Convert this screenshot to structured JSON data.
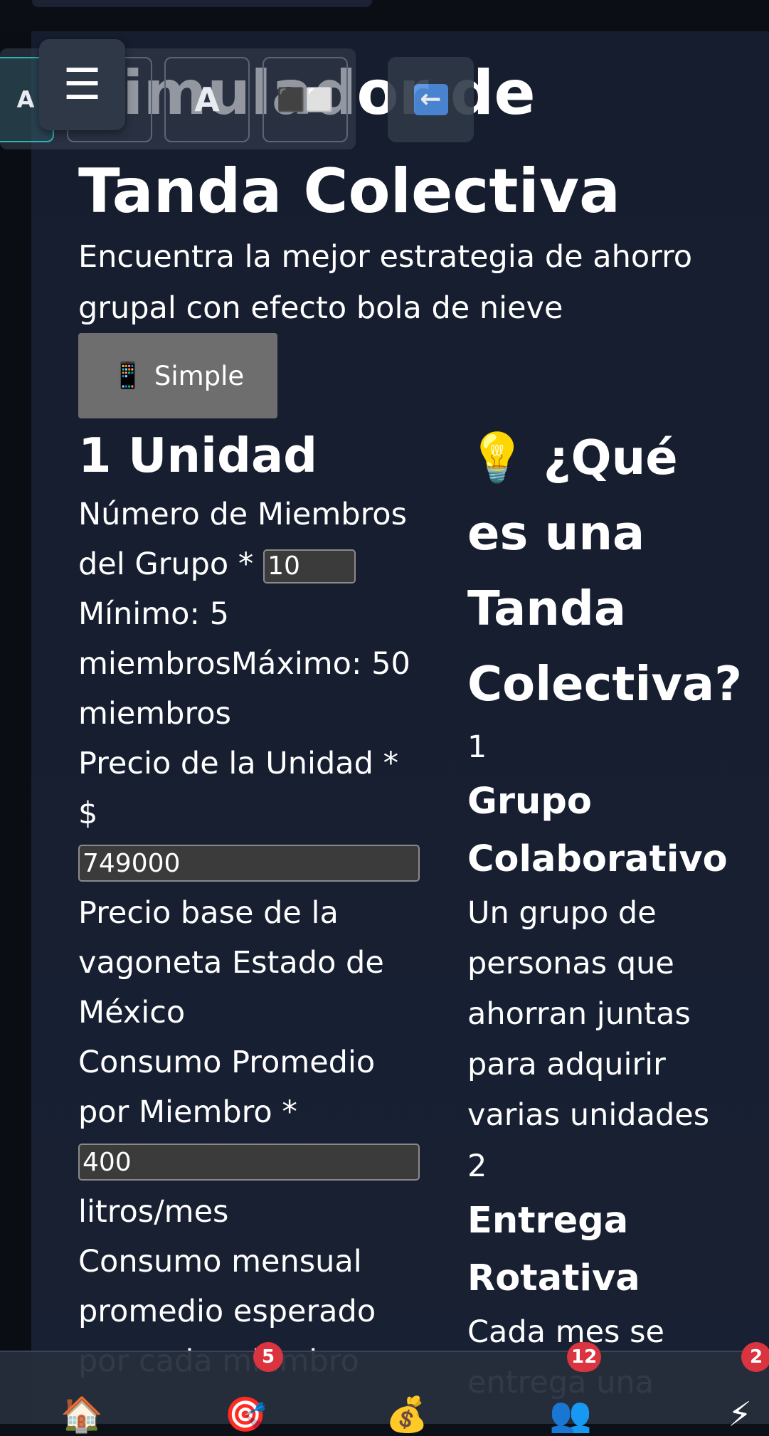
{
  "header": {
    "title_line1": "Simulador de",
    "title_line2": "Tanda Colectiva",
    "subtitle": "Encuentra la mejor estrategia de ahorro grupal con efecto bola de nieve"
  },
  "mode_button": {
    "icon": "📱",
    "label": "Simple"
  },
  "toolbar": {
    "font_a_label": "A",
    "font_a_large_label": "A",
    "contrast_icon": "⬛⬜",
    "back_icon": "⬅️"
  },
  "menu_button": {
    "icon": "☰"
  },
  "form": {
    "section_title": "1 Unidad",
    "members": {
      "label": "Número de Miembros del Grupo *",
      "value": "10",
      "hint_min": "Mínimo: 5 miembros",
      "hint_max": "Máximo: 50 miembros"
    },
    "price": {
      "label": "Precio de la Unidad *",
      "currency": "$",
      "value": "749000",
      "hint": "Precio base de la vagoneta Estado de México"
    },
    "consumption": {
      "label": "Consumo Promedio por Miembro *",
      "value": "400",
      "unit": "litros/mes",
      "hint": "Consumo mensual promedio esperado por cada miembro"
    }
  },
  "info": {
    "icon": "💡",
    "title": "¿Qué es una Tanda Colectiva?",
    "cards": [
      {
        "number": "1",
        "title": "Grupo Colaborativo",
        "text": "Un grupo de personas que ahorran juntas para adquirir varias unidades"
      },
      {
        "number": "2",
        "title": "Entrega Rotativa",
        "text": "Cada mes se entrega una"
      }
    ]
  },
  "bottom_nav": {
    "items": [
      {
        "icon": "🏠",
        "badge": ""
      },
      {
        "icon": "🎯",
        "badge": "5"
      },
      {
        "icon": "💰",
        "badge": ""
      },
      {
        "icon": "👥",
        "badge": "12"
      },
      {
        "icon": "⚡",
        "badge": "2"
      }
    ]
  }
}
